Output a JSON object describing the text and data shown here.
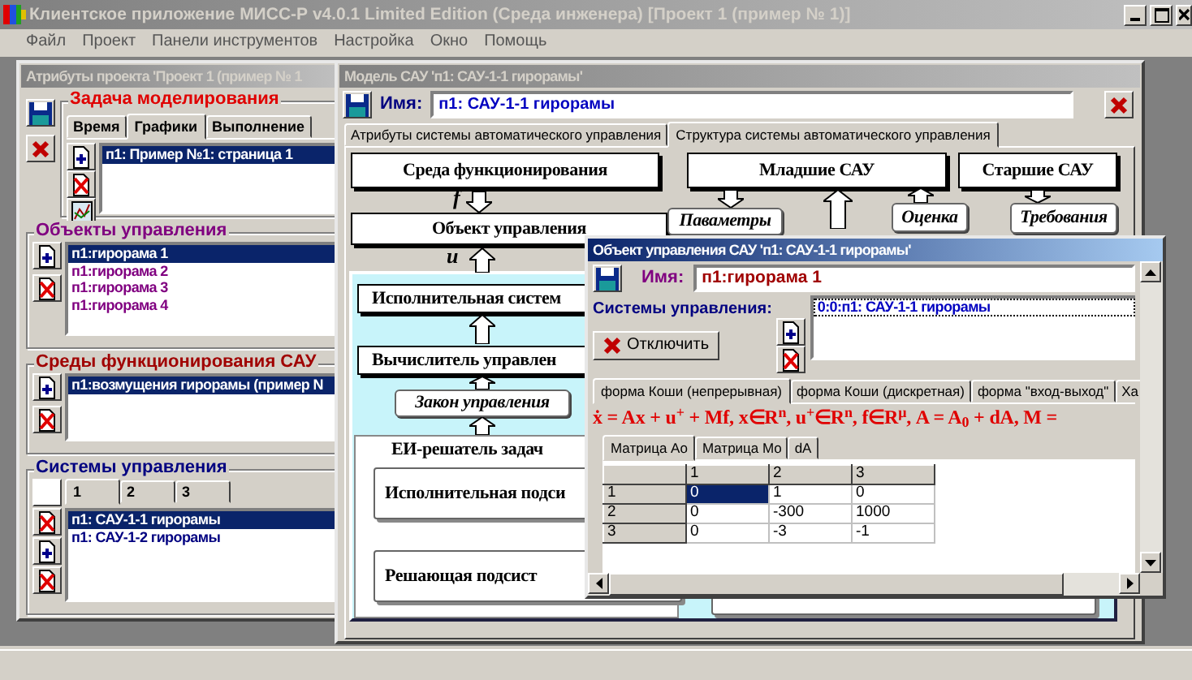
{
  "window": {
    "title": "Клиентское приложение МИСС-Р v4.0.1 Limited Edition (Среда инженера) [Проект 1 (пример № 1)]"
  },
  "menu": [
    "Файл",
    "Проект",
    "Панели инструментов",
    "Настройка",
    "Окно",
    "Помощь"
  ],
  "project_window": {
    "title": "Атрибуты проекта 'Проект 1 (пример № 1",
    "active": false,
    "task": {
      "label": "Задача моделирования",
      "tabs": [
        {
          "label": "Время",
          "selected": false
        },
        {
          "label": "Графики",
          "selected": true
        },
        {
          "label": "Выполнение",
          "selected": false
        }
      ],
      "items": [
        {
          "text": "п1: Пример №1: страница 1",
          "selected": true
        }
      ]
    },
    "objects": {
      "label": "Объекты управления",
      "items": [
        {
          "text": "п1:гирорама 1",
          "selected": true
        },
        {
          "text": "п1:гирорама 2",
          "selected": false
        },
        {
          "text": "п1:гирорама 3",
          "selected": false
        },
        {
          "text": "п1:гирорама 4",
          "selected": false
        }
      ]
    },
    "environments": {
      "label": "Среды функционирования САУ",
      "items": [
        {
          "text": "п1:возмущения гирорамы (пример N",
          "selected": true
        }
      ]
    },
    "systems": {
      "label": "Системы управления",
      "checked": false,
      "tabs": [
        {
          "label": "1",
          "selected": true
        },
        {
          "label": "2",
          "selected": false
        },
        {
          "label": "3",
          "selected": false
        }
      ],
      "items": [
        {
          "text": "п1: САУ-1-1 гирорамы",
          "selected": true
        },
        {
          "text": "п1: САУ-1-2 гирорамы",
          "selected": false
        }
      ]
    }
  },
  "model_window": {
    "title": "Модель САУ 'п1: САУ-1-1 гирорамы'",
    "active": false,
    "name_label": "Имя:",
    "name": "п1: САУ-1-1 гирорамы",
    "tabs": [
      {
        "label": "Атрибуты системы автоматического управления",
        "selected": false
      },
      {
        "label": "Структура системы автоматического управления",
        "selected": true
      }
    ],
    "diagram": {
      "labels": [
        "f",
        "u"
      ],
      "nodes": [
        {
          "text": "Среда функционирования",
          "kind": "box"
        },
        {
          "text": "Объект управления",
          "kind": "box"
        },
        {
          "text": "Младшие САУ",
          "kind": "box"
        },
        {
          "text": "Старшие САУ",
          "kind": "box"
        },
        {
          "text": "Паваметры",
          "kind": "note"
        },
        {
          "text": "Оценка",
          "kind": "note"
        },
        {
          "text": "Требования",
          "kind": "note"
        },
        {
          "text": "Исполнительная систем",
          "kind": "box"
        },
        {
          "text": "Вычислитель управлен",
          "kind": "box"
        },
        {
          "text": "Закон управления",
          "kind": "note"
        },
        {
          "text": "ЕИ-решатель задач",
          "kind": "panel"
        },
        {
          "text": "Исполнительная подси",
          "kind": "sub"
        },
        {
          "text": "Решающая подсист",
          "kind": "sub"
        }
      ]
    }
  },
  "object_window": {
    "title": "Объект управления САУ 'п1: САУ-1-1 гирорамы'",
    "active": true,
    "name_label": "Имя:",
    "name": "п1:гирорама 1",
    "systems_label": "Системы управления:",
    "systems": [
      {
        "text": "0:0:п1: САУ-1-1 гирорамы",
        "selected": true
      }
    ],
    "disconnect_button": "Отключить",
    "tabs": [
      {
        "label": "форма Коши (непрерывная)",
        "selected": true
      },
      {
        "label": "форма Коши (дискретная)",
        "selected": false
      },
      {
        "label": "форма \"вход-выход\"",
        "selected": false
      },
      {
        "label": "Ха",
        "selected": false
      }
    ],
    "formula": "ẋ = Ax + u$^{+}$ + Mf,  x∈R$^{n}$,  u$^{+}$∈R$^{n}$,  f∈R$^{μ}$,  A = A$_{0}$ + dA,  M =",
    "matrix_tabs": [
      {
        "label": "Матрица Ao",
        "selected": true
      },
      {
        "label": "Матрица Mo",
        "selected": false
      },
      {
        "label": "dA",
        "selected": false
      }
    ],
    "matrix": {
      "columns": [
        "1",
        "2",
        "3"
      ],
      "rows": [
        {
          "header": "1",
          "cells": [
            {
              "text": "0",
              "selected": true
            },
            {
              "text": "1",
              "selected": false
            },
            {
              "text": "0",
              "selected": false
            }
          ]
        },
        {
          "header": "2",
          "cells": [
            {
              "text": "0",
              "selected": false
            },
            {
              "text": "-300",
              "selected": false
            },
            {
              "text": "1000",
              "selected": false
            }
          ]
        },
        {
          "header": "3",
          "cells": [
            {
              "text": "0",
              "selected": false
            },
            {
              "text": "-3",
              "selected": false
            },
            {
              "text": "-1",
              "selected": false
            }
          ]
        }
      ]
    }
  }
}
